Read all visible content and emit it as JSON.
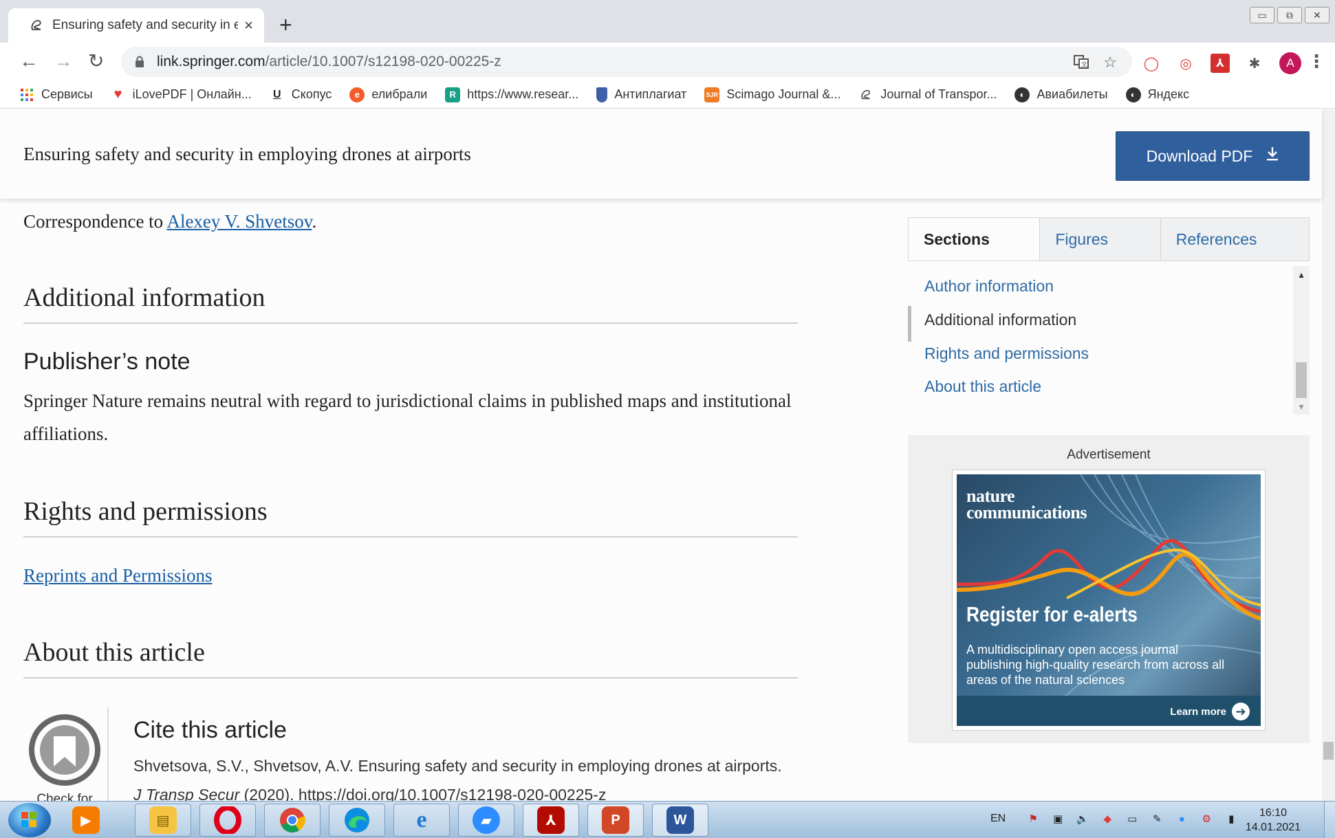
{
  "browser": {
    "tab_title": "Ensuring safety and security in em",
    "new_tab": "+",
    "close_tab": "×",
    "url_host": "link.springer.com",
    "url_path": "/article/10.1007/s12198-020-00225-z",
    "avatar_letter": "A",
    "bookmarks": [
      {
        "label": "Сервисы",
        "icon": "apps-grid-icon",
        "color": "#e53935"
      },
      {
        "label": "iLovePDF | Онлайн...",
        "icon": "heart-icon",
        "color": "#e53935"
      },
      {
        "label": "Скопус",
        "icon": "u-icon",
        "color": "#444444"
      },
      {
        "label": "елибрали",
        "icon": "elibrary-icon",
        "color": "#f25c2a"
      },
      {
        "label": "https://www.resear...",
        "icon": "researchgate-icon",
        "color": "#16a085"
      },
      {
        "label": "Антиплагиат",
        "icon": "shield-icon",
        "color": "#3f5fa8"
      },
      {
        "label": "Scimago Journal &...",
        "icon": "sjr-icon",
        "color": "#f07b24"
      },
      {
        "label": "Journal of Transpor...",
        "icon": "springer-icon",
        "color": "#555555"
      },
      {
        "label": "Авиабилеты",
        "icon": "globe-icon",
        "color": "#333333"
      },
      {
        "label": "Яндекс",
        "icon": "globe-icon",
        "color": "#333333"
      }
    ]
  },
  "header": {
    "title": "Ensuring safety and security in employing drones at airports",
    "download_label": "Download PDF"
  },
  "article": {
    "correspondence_prefix": "Correspondence to ",
    "correspondence_name": "Alexey V. Shvetsov",
    "correspondence_suffix": ".",
    "additional_info_heading": "Additional information",
    "publisher_note_heading": "Publisher’s note",
    "publisher_note_text": "Springer Nature remains neutral with regard to jurisdictional claims in published maps and institutional affiliations.",
    "rights_heading": "Rights and permissions",
    "reprints_link": "Reprints and Permissions",
    "about_heading": "About this article",
    "check_updates": "Check for updates",
    "cite_heading": "Cite this article",
    "cite_authors": "Shvetsova, S.V., Shvetsov, A.V. Ensuring safety and security in employing drones at airports. ",
    "cite_journal": "J Transp Secur",
    "cite_rest": " (2020). https://doi.org/10.1007/s12198-020-00225-z"
  },
  "sidebar": {
    "tabs": [
      "Sections",
      "Figures",
      "References"
    ],
    "items": [
      "Author information",
      "Additional information",
      "Rights and permissions",
      "About this article"
    ],
    "active_item": "Additional information"
  },
  "ad": {
    "label": "Advertisement",
    "logo_line1": "nature",
    "logo_line2": "communications",
    "headline": "Register for e-alerts",
    "body": "A multidisciplinary open access journal publishing high-quality research from across all areas of the natural sciences",
    "learn_more": "Learn more"
  },
  "taskbar": {
    "lang": "EN",
    "time": "16:10",
    "date": "14.01.2021",
    "apps": [
      "media-player-icon",
      "file-explorer-icon",
      "opera-icon",
      "chrome-icon",
      "edge-icon",
      "internet-explorer-icon",
      "zoom-icon",
      "acrobat-icon",
      "powerpoint-icon",
      "word-icon"
    ]
  },
  "colors": {
    "link": "#165da5",
    "download_button": "#2f5f9c",
    "sidebar_link": "#2e6aa5"
  }
}
